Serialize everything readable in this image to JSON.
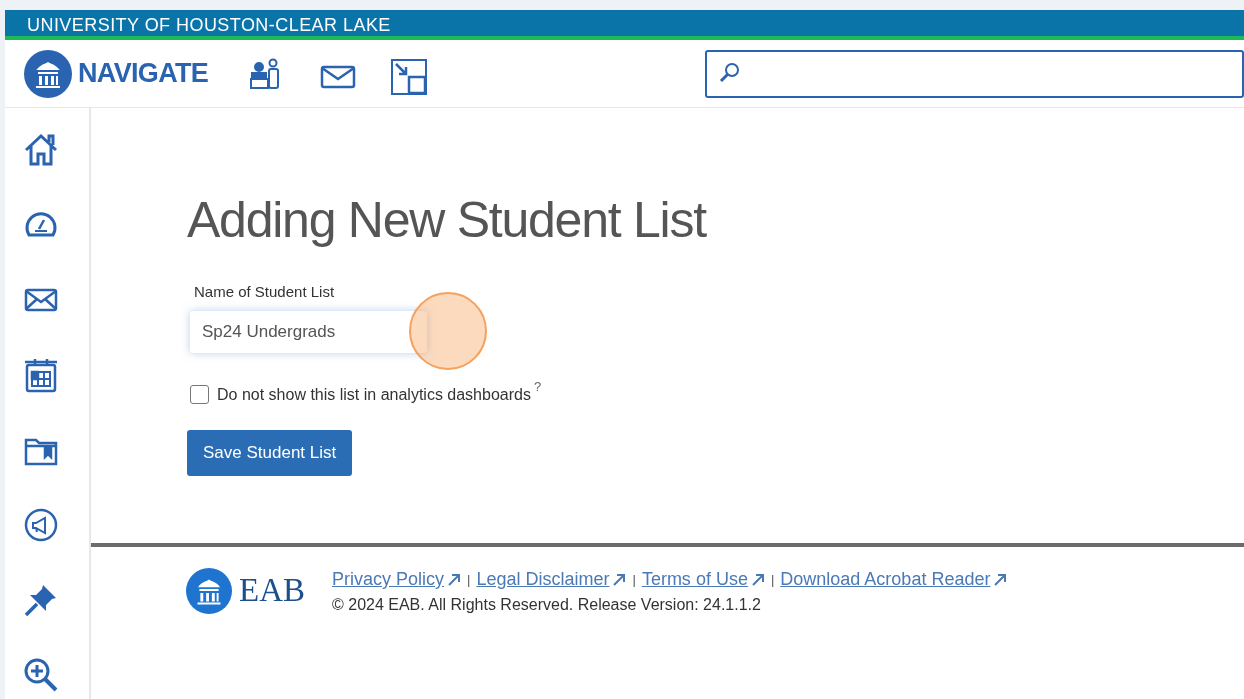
{
  "banner": {
    "title": "UNIVERSITY OF HOUSTON-CLEAR LAKE"
  },
  "header": {
    "brand": "NAVIGATE"
  },
  "page": {
    "title": "Adding New Student List",
    "name_field": {
      "label": "Name of Student List",
      "value": "Sp24 Undergrads"
    },
    "checkbox": {
      "label": "Do not show this list in analytics dashboards",
      "help": "?",
      "checked": false
    },
    "button": "Save Student List"
  },
  "footer": {
    "brand": "EAB",
    "links": [
      "Privacy Policy",
      "Legal Disclaimer",
      "Terms of Use",
      "Download Acrobat Reader"
    ],
    "separator": "|",
    "copyright": "© 2024 EAB. All Rights Reserved. Release Version: 24.1.1.2"
  }
}
